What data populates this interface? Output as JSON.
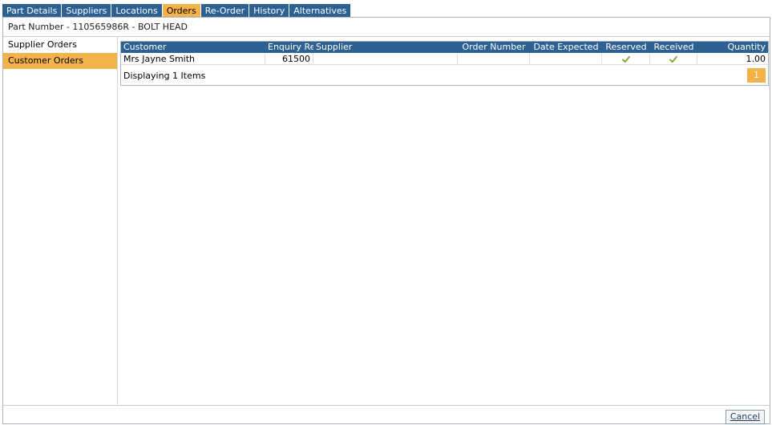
{
  "tabs": [
    {
      "label": "Part Details",
      "active": false
    },
    {
      "label": "Suppliers",
      "active": false
    },
    {
      "label": "Locations",
      "active": false
    },
    {
      "label": "Orders",
      "active": true
    },
    {
      "label": "Re-Order",
      "active": false
    },
    {
      "label": "History",
      "active": false
    },
    {
      "label": "Alternatives",
      "active": false
    }
  ],
  "part_header": "Part Number - 110565986R - BOLT HEAD",
  "sidebar": {
    "items": [
      {
        "label": "Supplier Orders",
        "active": false
      },
      {
        "label": "Customer Orders",
        "active": true
      }
    ]
  },
  "grid": {
    "columns": [
      "Customer",
      "Enquiry Ref",
      "Supplier",
      "Order Number",
      "Date Expected",
      "Reserved",
      "Received",
      "Quantity"
    ],
    "rows": [
      {
        "customer": "Mrs Jayne Smith",
        "enquiry_ref": "61500",
        "supplier": "",
        "order_number": "",
        "date_expected": "",
        "reserved": true,
        "received": true,
        "quantity": "1.00"
      }
    ],
    "footer_text": "Displaying 1 Items",
    "current_page": "1"
  },
  "buttons": {
    "cancel": "Cancel"
  },
  "colors": {
    "tab_bg": "#2e6193",
    "accent": "#f4b24b",
    "check": "#7aa62a"
  }
}
